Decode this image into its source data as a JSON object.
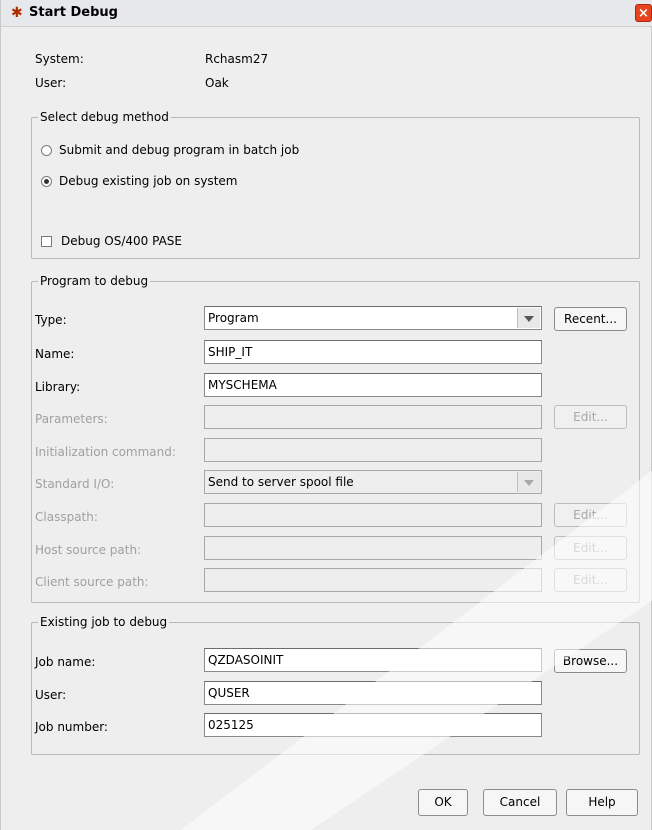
{
  "window": {
    "title": "Start Debug",
    "icon": "bug-icon",
    "close": "×"
  },
  "info": {
    "system_label": "System:",
    "system_value": "Rchasm27",
    "user_label": "User:",
    "user_value": "Oak"
  },
  "debug_method": {
    "legend": "Select debug method",
    "options": [
      {
        "label": "Submit and debug program in batch job",
        "selected": false
      },
      {
        "label": "Debug existing job on system",
        "selected": true
      }
    ],
    "pase": {
      "label": "Debug OS/400 PASE",
      "checked": false
    }
  },
  "program": {
    "legend": "Program to debug",
    "type_label": "Type:",
    "type_value": "Program",
    "recent_button": "Recent...",
    "name_label": "Name:",
    "name_value": "SHIP_IT",
    "library_label": "Library:",
    "library_value": "MYSCHEMA",
    "parameters_label": "Parameters:",
    "parameters_value": "",
    "edit_button": "Edit...",
    "init_label": "Initialization command:",
    "init_value": "",
    "stdio_label": "Standard I/O:",
    "stdio_value": "Send to server spool file",
    "classpath_label": "Classpath:",
    "classpath_value": "",
    "host_label": "Host source path:",
    "host_value": "",
    "client_label": "Client source path:",
    "client_value": ""
  },
  "job": {
    "legend": "Existing job to debug",
    "name_label": "Job name:",
    "name_value": "QZDASOINIT",
    "browse_button": "Browse...",
    "user_label": "User:",
    "user_value": "QUSER",
    "number_label": "Job number:",
    "number_value": "025125"
  },
  "buttons": {
    "ok": "OK",
    "cancel": "Cancel",
    "help": "Help"
  }
}
